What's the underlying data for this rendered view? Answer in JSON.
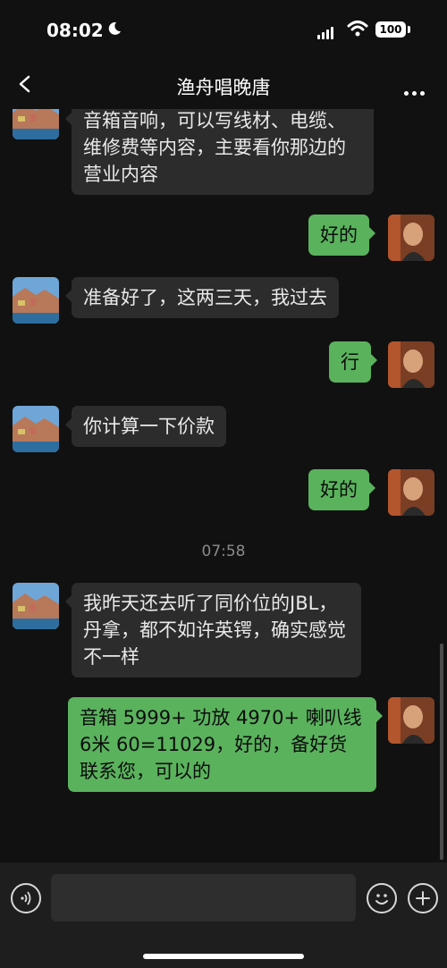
{
  "status": {
    "time": "08:02",
    "battery": "100"
  },
  "header": {
    "title": "渔舟唱晚唐"
  },
  "messages": [
    {
      "text": "音箱音响，可以写线材、电缆、维修费等内容，主要看你那边的营业内容"
    },
    {
      "text": "好的"
    },
    {
      "text": "准备好了，这两三天，我过去"
    },
    {
      "text": "行"
    },
    {
      "text": "你计算一下价款"
    },
    {
      "text": "好的"
    },
    {
      "text": "我昨天还去听了同价位的JBL，丹拿，都不如许英锷，确实感觉不一样"
    },
    {
      "text": "音箱 5999+ 功放 4970+ 喇叭线 6米 60=11029，好的，备好货联系您，可以的"
    }
  ],
  "timestamp": "07:58",
  "icons": {
    "back": "chevron-left-icon",
    "more": "more-dots-icon",
    "voice": "voice-icon",
    "emoji": "emoji-icon",
    "plus": "plus-icon"
  },
  "colors": {
    "background": "#111111",
    "incoming_bubble": "#2c2c2c",
    "outgoing_bubble": "#5ab25d"
  }
}
